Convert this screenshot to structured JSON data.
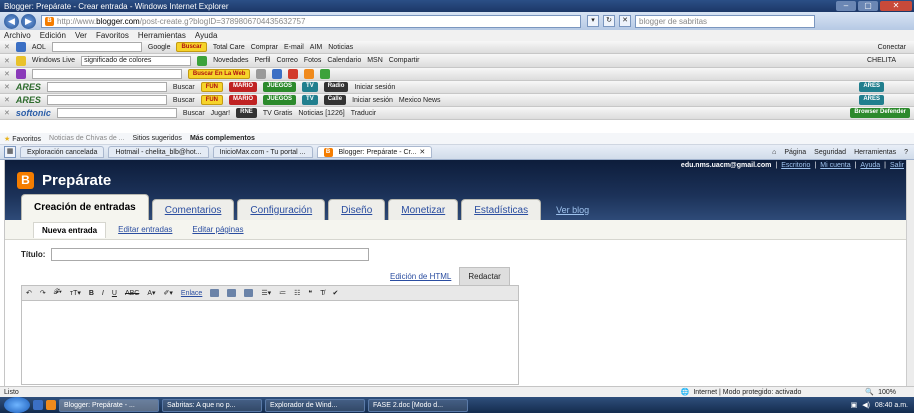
{
  "window": {
    "title": "Blogger: Prepárate - Crear entrada - Windows Internet Explorer"
  },
  "address": {
    "url_prefix": "http://www.",
    "url_domain": "blogger.com",
    "url_rest": "/post-create.g?blogID=3789806704435632757",
    "search_placeholder": "blogger de sabritas"
  },
  "menu": [
    "Archivo",
    "Edición",
    "Ver",
    "Favoritos",
    "Herramientas",
    "Ayuda"
  ],
  "toolbar1": {
    "aol": "AOL",
    "google": "Google",
    "buscar": "Buscar",
    "items": [
      "Total Care",
      "Comprar",
      "E-mail",
      "AIM",
      "Noticias"
    ],
    "right": "Conectar"
  },
  "toolbar2": {
    "brand": "Windows Live",
    "query": "significado de colores",
    "items": [
      "Novedades",
      "Perfil",
      "Correo",
      "Fotos",
      "Calendario",
      "MSN",
      "Compartir"
    ],
    "right": "CHELITA"
  },
  "toolbar3": {
    "search_btn": "Buscar En La Web"
  },
  "toolbar4": {
    "brand": "ARES",
    "buscar": "Buscar",
    "pill1": "FUN",
    "pill2": "MARIO",
    "pill3": "JUEGOS",
    "pill4": "TV",
    "radio": "Radio",
    "login": "Iniciar sesión",
    "badge": "ARES"
  },
  "toolbar5": {
    "brand": "ARES",
    "buscar": "Buscar",
    "pill1": "FUN",
    "pill2": "MARIO",
    "pill3": "JUEGOS",
    "pill4": "TV",
    "radio": "Calle",
    "login": "Iniciar sesión",
    "news": "Mexico News",
    "badge": "ARES"
  },
  "toolbar6": {
    "brand": "softonic",
    "buscar": "Buscar",
    "jugar": "Jugar!",
    "tv": "TV Gratis",
    "noticias": "Noticias [1226]",
    "traducir": "Traducir",
    "defender": "Browser Defender"
  },
  "favbar": {
    "favoritos": "Favoritos",
    "chivas": "Noticias de Chivas de ...",
    "sugeridos": "Sitios sugeridos",
    "complementos": "Más complementos"
  },
  "tabs": [
    {
      "label": "Exploración cancelada",
      "active": false
    },
    {
      "label": "Hotmail - chelita_blb@hot...",
      "active": false
    },
    {
      "label": "InicioMax.com - Tu portal ...",
      "active": false
    },
    {
      "label": "Blogger: Prepárate - Cr...",
      "active": true
    }
  ],
  "tab_tools": [
    "Página",
    "Seguridad",
    "Herramientas"
  ],
  "blogger": {
    "blog_name": "Prepárate",
    "email": "edu.nms.uacm@gmail.com",
    "links": [
      "Escritorio",
      "Mi cuenta",
      "Ayuda",
      "Salir"
    ],
    "tabs": [
      "Creación de entradas",
      "Comentarios",
      "Configuración",
      "Diseño",
      "Monetizar",
      "Estadísticas"
    ],
    "ver_blog": "Ver blog",
    "subtabs": [
      "Nueva entrada",
      "Editar entradas",
      "Editar páginas"
    ],
    "title_label": "Título:",
    "edit_html": "Edición de HTML",
    "compose": "Redactar",
    "link_btn": "Enlace"
  },
  "status": {
    "left": "Listo",
    "zone": "Internet | Modo protegido: activado",
    "zoom": "100%"
  },
  "taskbar": {
    "items": [
      "Blogger: Prepárate - ...",
      "Sabritas: A que no p...",
      "Explorador de Wind...",
      "FASE 2.doc [Modo d..."
    ],
    "clock": "08:40 a.m."
  }
}
